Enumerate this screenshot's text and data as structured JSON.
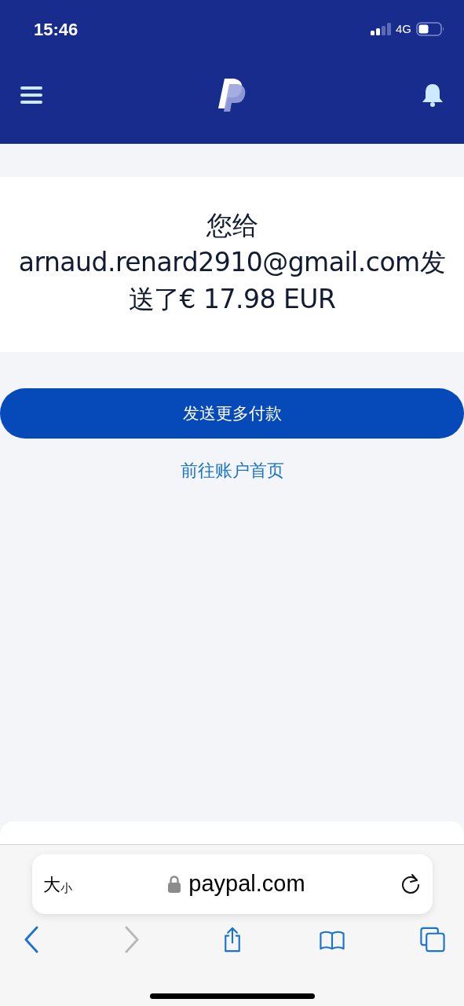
{
  "status_bar": {
    "time": "15:46",
    "network": "4G"
  },
  "message": "您给 arnaud.renard2910@gmail.com发送了€ 17.98 EUR",
  "primary_button": "发送更多付款",
  "link": "前往账户首页",
  "browser": {
    "text_size": {
      "large": "大",
      "small": "小"
    },
    "url": "paypal.com",
    "toolbar": [
      {
        "kind": "back",
        "disabled": false
      },
      {
        "kind": "forward",
        "disabled": true
      },
      {
        "kind": "share",
        "disabled": false
      },
      {
        "kind": "bookmarks",
        "disabled": false
      },
      {
        "kind": "tabs",
        "disabled": false
      }
    ]
  }
}
